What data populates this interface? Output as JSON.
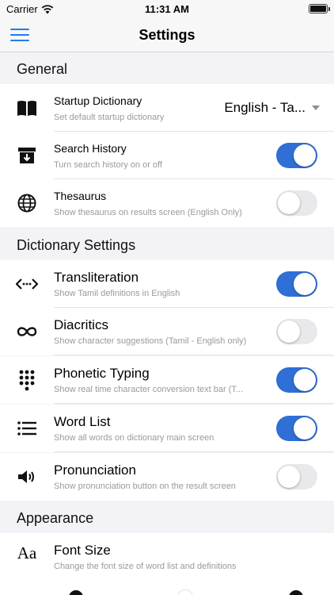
{
  "status_bar": {
    "carrier": "Carrier",
    "time": "11:31 AM"
  },
  "nav": {
    "title": "Settings"
  },
  "sections": {
    "general": "General",
    "dictionary": "Dictionary Settings",
    "appearance": "Appearance"
  },
  "rows": {
    "startup": {
      "label": "Startup Dictionary",
      "sub": "Set default startup dictionary",
      "value": "English - Ta..."
    },
    "history": {
      "label": "Search History",
      "sub": "Turn search history on or off",
      "on": true
    },
    "thesaurus": {
      "label": "Thesaurus",
      "sub": "Show thesaurus on results screen (English Only)",
      "on": false
    },
    "translit": {
      "label": "Transliteration",
      "sub": "Show Tamil definitions in English",
      "on": true
    },
    "diacritics": {
      "label": "Diacritics",
      "sub": "Show character suggestions (Tamil - English only)",
      "on": false
    },
    "phonetic": {
      "label": "Phonetic Typing",
      "sub": "Show real time character conversion text bar (T...",
      "on": true
    },
    "wordlist": {
      "label": "Word List",
      "sub": "Show all words on dictionary main screen",
      "on": true
    },
    "pronunciation": {
      "label": "Pronunciation",
      "sub": "Show pronunciation button on the result screen",
      "on": false
    },
    "fontsize": {
      "label": "Font Size",
      "sub": "Change the font size of word list and definitions",
      "icon_text": "Aa"
    }
  },
  "colors": {
    "accent": "#2f6fd6",
    "menu": "#1f7cf0",
    "toggle_off": "#e9e9eb"
  }
}
